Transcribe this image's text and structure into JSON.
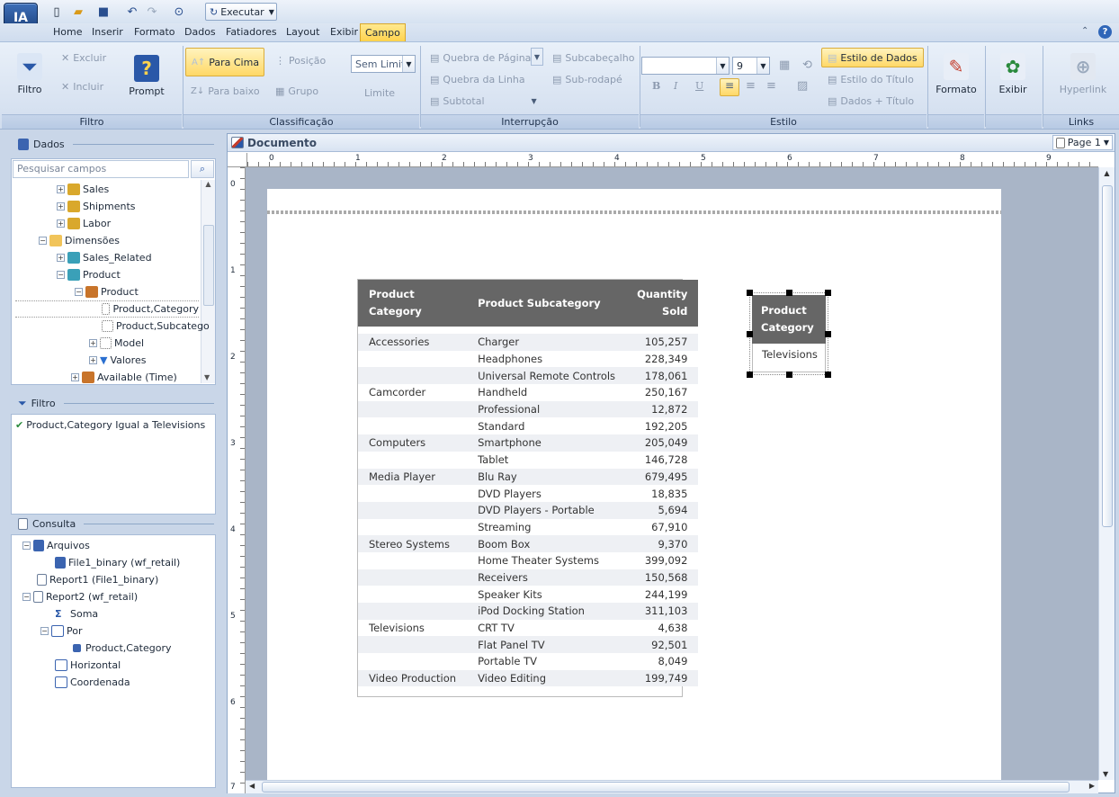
{
  "app": {
    "logo": "IA"
  },
  "quick_access": {
    "run_label": "Executar"
  },
  "menu": {
    "tabs": [
      "Home",
      "Inserir",
      "Formato",
      "Dados",
      "Fatiadores",
      "Layout",
      "Exibir",
      "Campo"
    ],
    "active": "Campo"
  },
  "ribbon": {
    "filtro": {
      "filter": "Filtro",
      "exclude": "Excluir",
      "include": "Incluir",
      "prompt": "Prompt",
      "label": "Filtro"
    },
    "classificacao": {
      "up": "Para Cima",
      "down": "Para baixo",
      "position": "Posição",
      "group": "Grupo",
      "limit_value": "Sem Limit",
      "limit": "Limite",
      "label": "Classificação"
    },
    "interrupcao": {
      "page_break": "Quebra de Página",
      "line_break": "Quebra da Linha",
      "subtotal": "Subtotal",
      "subheader": "Subcabeçalho",
      "subfooter": "Sub-rodapé",
      "label": "Interrupção"
    },
    "estilo": {
      "font_value": "",
      "size_value": "9",
      "data_style": "Estilo de Dados",
      "title_style": "Estilo do Título",
      "data_title": "Dados + Título",
      "bold": "B",
      "italic": "I",
      "underline": "U",
      "label": "Estilo"
    },
    "formato": "Formato",
    "exibir": "Exibir",
    "links": {
      "hyperlink": "Hyperlink",
      "label": "Links"
    }
  },
  "dados_panel": {
    "title": "Dados",
    "search_placeholder": "Pesquisar campos",
    "tree": [
      {
        "label": "Sales"
      },
      {
        "label": "Shipments"
      },
      {
        "label": "Labor"
      },
      {
        "label": "Dimensões"
      },
      {
        "label": "Sales_Related"
      },
      {
        "label": "Product"
      },
      {
        "label": "Product"
      },
      {
        "label": "Product,Category"
      },
      {
        "label": "Product,Subcatego"
      },
      {
        "label": "Model"
      },
      {
        "label": "Valores"
      },
      {
        "label": "Available (Time)"
      }
    ]
  },
  "filtro_panel": {
    "title": "Filtro",
    "condition": "Product,Category Igual a Televisions"
  },
  "consulta_panel": {
    "title": "Consulta",
    "tree": [
      {
        "label": "Arquivos"
      },
      {
        "label": "File1_binary (wf_retail)"
      },
      {
        "label": "Report1 (File1_binary)"
      },
      {
        "label": "Report2 (wf_retail)"
      },
      {
        "label": "Soma"
      },
      {
        "label": "Por"
      },
      {
        "label": "Product,Category"
      },
      {
        "label": "Horizontal"
      },
      {
        "label": "Coordenada"
      }
    ]
  },
  "document": {
    "title": "Documento",
    "page_selector": "Page 1",
    "ruler_h": [
      "0",
      "1",
      "2",
      "3",
      "4",
      "5",
      "6",
      "7",
      "8",
      "9"
    ],
    "ruler_v": [
      "0",
      "1",
      "2",
      "3",
      "4",
      "5",
      "6",
      "7"
    ],
    "report": {
      "headers": {
        "category": "Product Category",
        "subcategory": "Product Subcategory",
        "quantity": "Quantity Sold"
      },
      "rows": [
        {
          "category": "Accessories",
          "subcategory": "Charger",
          "quantity": "105,257"
        },
        {
          "category": "",
          "subcategory": "Headphones",
          "quantity": "228,349"
        },
        {
          "category": "",
          "subcategory": "Universal Remote Controls",
          "quantity": "178,061"
        },
        {
          "category": "Camcorder",
          "subcategory": "Handheld",
          "quantity": "250,167"
        },
        {
          "category": "",
          "subcategory": "Professional",
          "quantity": "12,872"
        },
        {
          "category": "",
          "subcategory": "Standard",
          "quantity": "192,205"
        },
        {
          "category": "Computers",
          "subcategory": "Smartphone",
          "quantity": "205,049"
        },
        {
          "category": "",
          "subcategory": "Tablet",
          "quantity": "146,728"
        },
        {
          "category": "Media Player",
          "subcategory": "Blu Ray",
          "quantity": "679,495"
        },
        {
          "category": "",
          "subcategory": "DVD Players",
          "quantity": "18,835"
        },
        {
          "category": "",
          "subcategory": "DVD Players - Portable",
          "quantity": "5,694"
        },
        {
          "category": "",
          "subcategory": "Streaming",
          "quantity": "67,910"
        },
        {
          "category": "Stereo Systems",
          "subcategory": "Boom Box",
          "quantity": "9,370"
        },
        {
          "category": "",
          "subcategory": "Home Theater Systems",
          "quantity": "399,092"
        },
        {
          "category": "",
          "subcategory": "Receivers",
          "quantity": "150,568"
        },
        {
          "category": "",
          "subcategory": "Speaker Kits",
          "quantity": "244,199"
        },
        {
          "category": "",
          "subcategory": "iPod Docking Station",
          "quantity": "311,103"
        },
        {
          "category": "Televisions",
          "subcategory": "CRT TV",
          "quantity": "4,638"
        },
        {
          "category": "",
          "subcategory": "Flat Panel TV",
          "quantity": "92,501"
        },
        {
          "category": "",
          "subcategory": "Portable TV",
          "quantity": "8,049"
        },
        {
          "category": "Video Production",
          "subcategory": "Video Editing",
          "quantity": "199,749"
        }
      ]
    },
    "filter_object": {
      "header": "Product Category",
      "value": "Televisions"
    }
  },
  "colors": {
    "accent": "#ffd24d",
    "header_gray": "#666666",
    "canvas": "#a9b5c7"
  }
}
